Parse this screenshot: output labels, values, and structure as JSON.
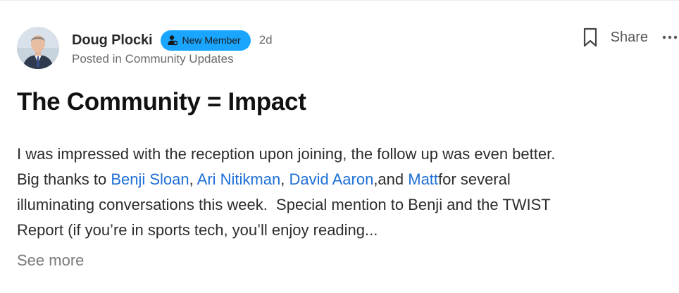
{
  "post": {
    "author": {
      "name": "Doug Plocki",
      "badge": "New Member",
      "time": "2d",
      "posted_in": "Posted in Community Updates"
    },
    "actions": {
      "bookmark_icon": "bookmark-icon",
      "share_label": "Share",
      "more_icon": "more-horizontal-icon"
    },
    "title": "The Community = Impact",
    "body": {
      "line1": "I was impressed with the reception upon joining, the follow up was even better.",
      "line2_prefix": "Big thanks to ",
      "mention1": "Benji Sloan",
      "sep1": ", ",
      "mention2": "Ari Nitikman",
      "sep2": ", ",
      "mention3": "David Aaron",
      "sep3": ",and ",
      "mention4": "Matt",
      "line2_suffix": "for several",
      "line3": "illuminating conversations this week.  Special mention to Benji and the TWIST",
      "line4": "Report (if you’re in sports tech, you’ll enjoy reading..."
    },
    "see_more": "See more"
  },
  "colors": {
    "badge": "#1aa6ff",
    "mention": "#1d6fd6",
    "muted": "#6b6b6b"
  }
}
